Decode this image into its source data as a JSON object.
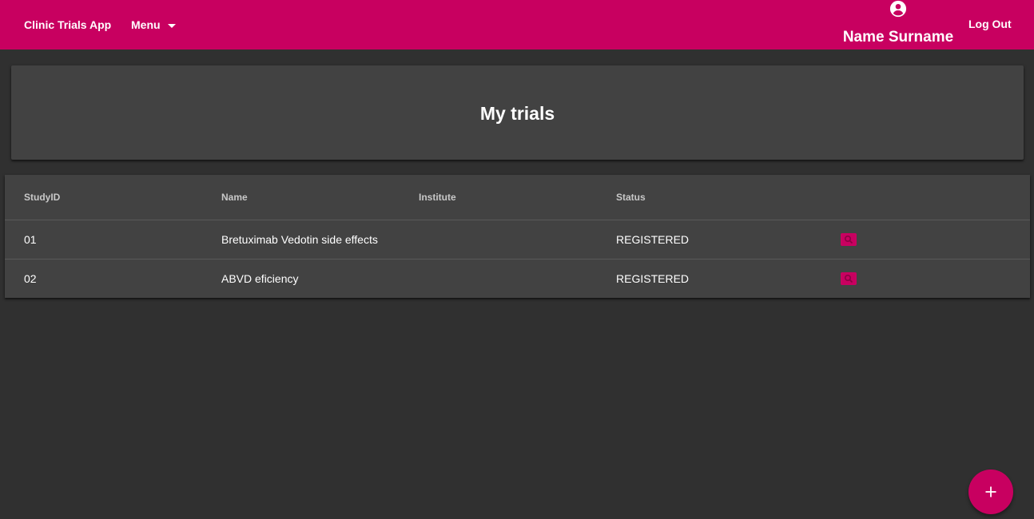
{
  "header": {
    "app_title": "Clinic Trials App",
    "menu_label": "Menu",
    "user_name": "Name Surname",
    "logout_label": "Log Out"
  },
  "page": {
    "title": "My trials"
  },
  "table": {
    "columns": [
      "StudyID",
      "Name",
      "Institute",
      "Status"
    ],
    "rows": [
      {
        "study_id": "01",
        "name": "Bretuximab Vedotin side effects",
        "institute": "",
        "status": "REGISTERED"
      },
      {
        "study_id": "02",
        "name": "ABVD eficiency",
        "institute": "",
        "status": "REGISTERED"
      }
    ]
  },
  "icons": {
    "user": "account-circle-icon",
    "menu_caret": "chevron-down-icon",
    "row_action": "view-icon",
    "fab": "plus-icon"
  },
  "colors": {
    "accent": "#c80060",
    "background": "#303030",
    "surface": "#424242"
  }
}
